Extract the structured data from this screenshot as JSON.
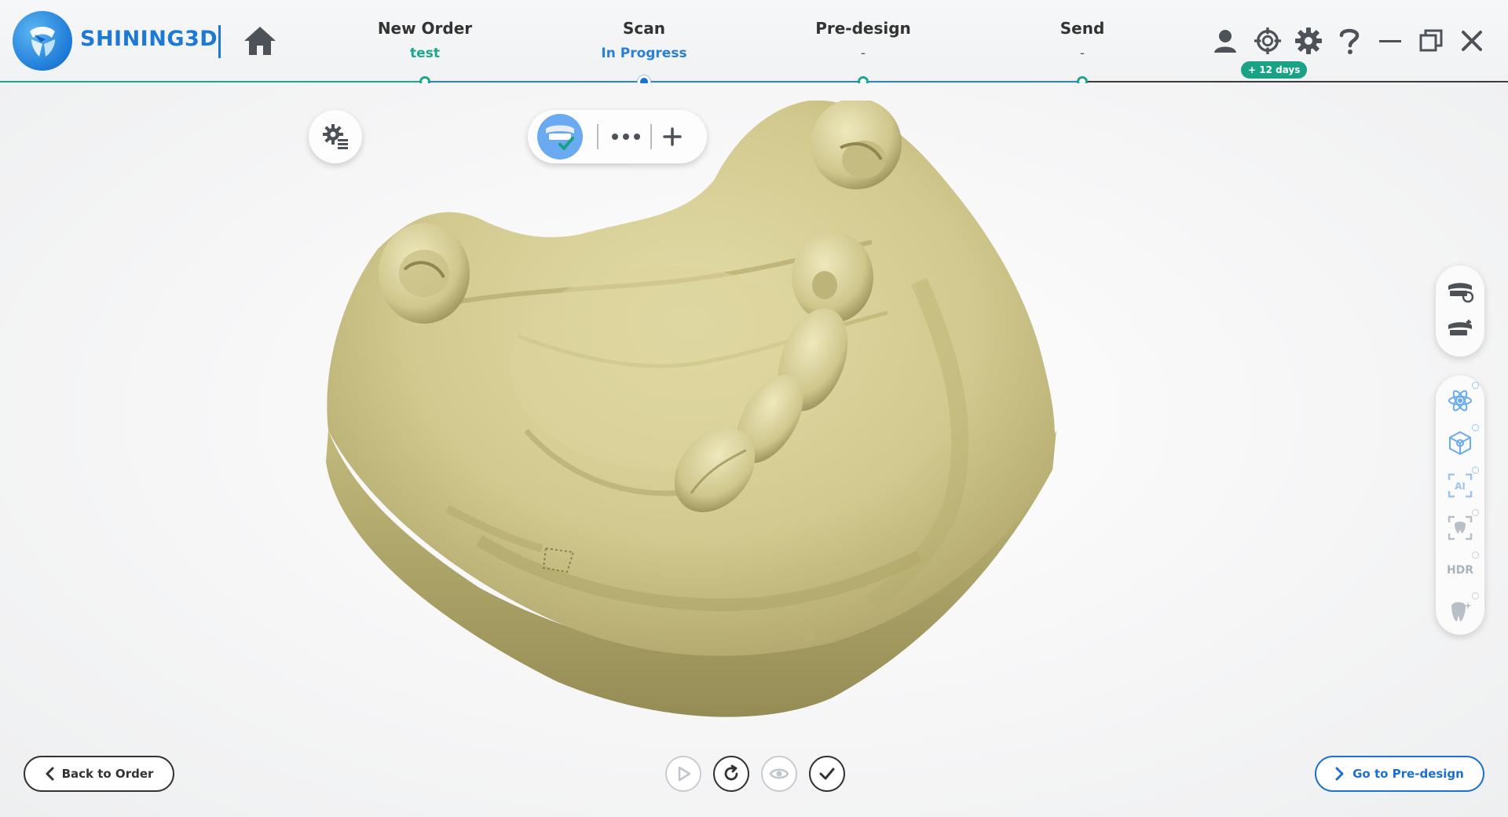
{
  "app": {
    "brand": "SHINING3D",
    "colors": {
      "brand_blue": "#1d79d3",
      "step_green": "#1da68e",
      "step_blue": "#2a7fd6",
      "model_yellow": "#cfc690"
    }
  },
  "steps": [
    {
      "label": "New Order",
      "sub": "test",
      "state": "done"
    },
    {
      "label": "Scan",
      "sub": "In Progress",
      "state": "current"
    },
    {
      "label": "Pre-design",
      "sub": "-",
      "state": "pending"
    },
    {
      "label": "Send",
      "sub": "-",
      "state": "pending"
    }
  ],
  "header": {
    "trial_badge": "+ 12 days",
    "icons": [
      "user-icon",
      "target-icon",
      "gear-icon",
      "help-icon",
      "minimize-icon",
      "restore-icon",
      "close-icon"
    ]
  },
  "side_panel": {
    "hdr_label": "HDR",
    "ai_label": "AI"
  },
  "bottom": {
    "back_label": "Back to Order",
    "next_label": "Go to Pre-design"
  }
}
